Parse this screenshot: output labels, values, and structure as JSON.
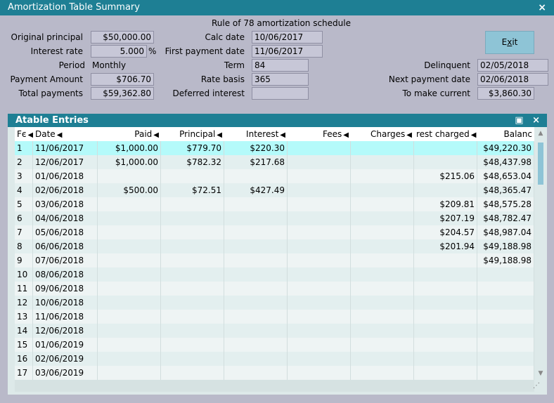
{
  "window": {
    "title": "Amortization Table Summary",
    "close_glyph": "×"
  },
  "header": {
    "schedule_title": "Rule of 78 amortization schedule",
    "original_principal": {
      "label": "Original principal",
      "value": "$50,000.00"
    },
    "interest_rate": {
      "label": "Interest rate",
      "value": "5.000",
      "unit": "%"
    },
    "period": {
      "label": "Period",
      "value": "Monthly"
    },
    "payment_amount": {
      "label": "Payment Amount",
      "value": "$706.70"
    },
    "total_payments": {
      "label": "Total payments",
      "value": "$59,362.80"
    },
    "calc_date": {
      "label": "Calc date",
      "value": "10/06/2017"
    },
    "first_payment_date": {
      "label": "First payment date",
      "value": "11/06/2017"
    },
    "term": {
      "label": "Term",
      "value": "84"
    },
    "rate_basis": {
      "label": "Rate basis",
      "value": "365"
    },
    "deferred_interest": {
      "label": "Deferred interest",
      "value": ""
    },
    "delinquent": {
      "label": "Delinquent",
      "value": "02/05/2018"
    },
    "next_payment_date": {
      "label": "Next payment date",
      "value": "02/06/2018"
    },
    "to_make_current": {
      "label": "To make current",
      "value": "$3,860.30"
    },
    "exit_button": {
      "label_prefix": "E",
      "label_underlined": "x",
      "label_suffix": "it"
    }
  },
  "panel": {
    "title": "Atable Entries",
    "maximize_glyph": "▣",
    "close_glyph": "×",
    "columns": [
      "Ϝє",
      "Date",
      "Paid",
      "Principal",
      "Interest",
      "Fees",
      "Charges",
      "rest charged",
      "Balanc"
    ],
    "sort_glyph": "◀",
    "rows": [
      [
        "1",
        "11/06/2017",
        "$1,000.00",
        "$779.70",
        "$220.30",
        "",
        "",
        "",
        "$49,220.30"
      ],
      [
        "2",
        "12/06/2017",
        "$1,000.00",
        "$782.32",
        "$217.68",
        "",
        "",
        "",
        "$48,437.98"
      ],
      [
        "3",
        "01/06/2018",
        "",
        "",
        "",
        "",
        "",
        "$215.06",
        "$48,653.04"
      ],
      [
        "4",
        "02/06/2018",
        "$500.00",
        "$72.51",
        "$427.49",
        "",
        "",
        "",
        "$48,365.47"
      ],
      [
        "5",
        "03/06/2018",
        "",
        "",
        "",
        "",
        "",
        "$209.81",
        "$48,575.28"
      ],
      [
        "6",
        "04/06/2018",
        "",
        "",
        "",
        "",
        "",
        "$207.19",
        "$48,782.47"
      ],
      [
        "7",
        "05/06/2018",
        "",
        "",
        "",
        "",
        "",
        "$204.57",
        "$48,987.04"
      ],
      [
        "8",
        "06/06/2018",
        "",
        "",
        "",
        "",
        "",
        "$201.94",
        "$49,188.98"
      ],
      [
        "9",
        "07/06/2018",
        "",
        "",
        "",
        "",
        "",
        "",
        "$49,188.98"
      ],
      [
        "10",
        "08/06/2018",
        "",
        "",
        "",
        "",
        "",
        "",
        ""
      ],
      [
        "11",
        "09/06/2018",
        "",
        "",
        "",
        "",
        "",
        "",
        ""
      ],
      [
        "12",
        "10/06/2018",
        "",
        "",
        "",
        "",
        "",
        "",
        ""
      ],
      [
        "13",
        "11/06/2018",
        "",
        "",
        "",
        "",
        "",
        "",
        ""
      ],
      [
        "14",
        "12/06/2018",
        "",
        "",
        "",
        "",
        "",
        "",
        ""
      ],
      [
        "15",
        "01/06/2019",
        "",
        "",
        "",
        "",
        "",
        "",
        ""
      ],
      [
        "16",
        "02/06/2019",
        "",
        "",
        "",
        "",
        "",
        "",
        ""
      ],
      [
        "17",
        "03/06/2019",
        "",
        "",
        "",
        "",
        "",
        "",
        ""
      ]
    ],
    "selected_row": 0
  },
  "colors": {
    "titlebar": "#1e7f94",
    "background": "#b9b9c9",
    "selected_row": "#b4fafa",
    "button": "#8ec4d6"
  }
}
